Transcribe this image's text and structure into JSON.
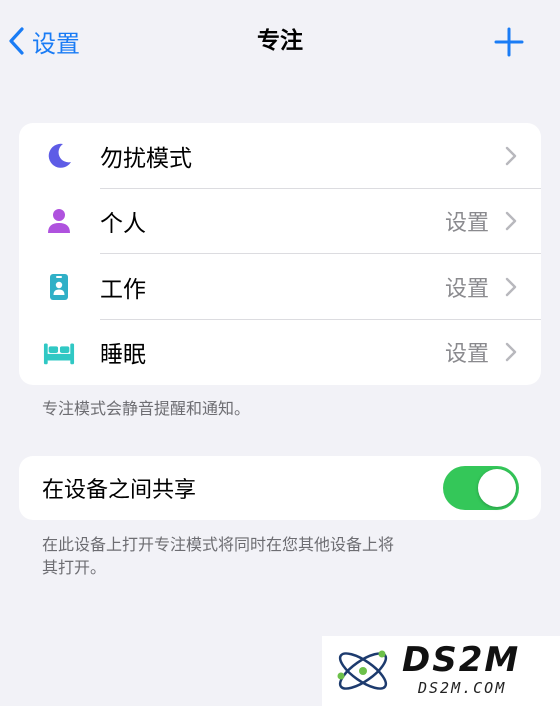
{
  "nav": {
    "back_label": "设置",
    "title": "专注"
  },
  "focus_list": {
    "items": [
      {
        "label": "勿扰模式",
        "value": "",
        "icon": "moon-icon",
        "icon_color": "#5e5ce6"
      },
      {
        "label": "个人",
        "value": "设置",
        "icon": "person-icon",
        "icon_color": "#af52de"
      },
      {
        "label": "工作",
        "value": "设置",
        "icon": "badge-icon",
        "icon_color": "#30b0c7"
      },
      {
        "label": "睡眠",
        "value": "设置",
        "icon": "bed-icon",
        "icon_color": "#30c8c4"
      }
    ],
    "footnote": "专注模式会静音提醒和通知。"
  },
  "share": {
    "label": "在设备之间共享",
    "enabled": true,
    "footnote_line1": "在此设备上打开专注模式将同时在您其他设备上将",
    "footnote_line2": "其打开。"
  },
  "watermark": {
    "main": "DS2M",
    "sub": "DS2M.COM"
  },
  "colors": {
    "accent": "#1a7cf5",
    "toggle_on": "#34c759",
    "background": "#f2f2f7"
  }
}
